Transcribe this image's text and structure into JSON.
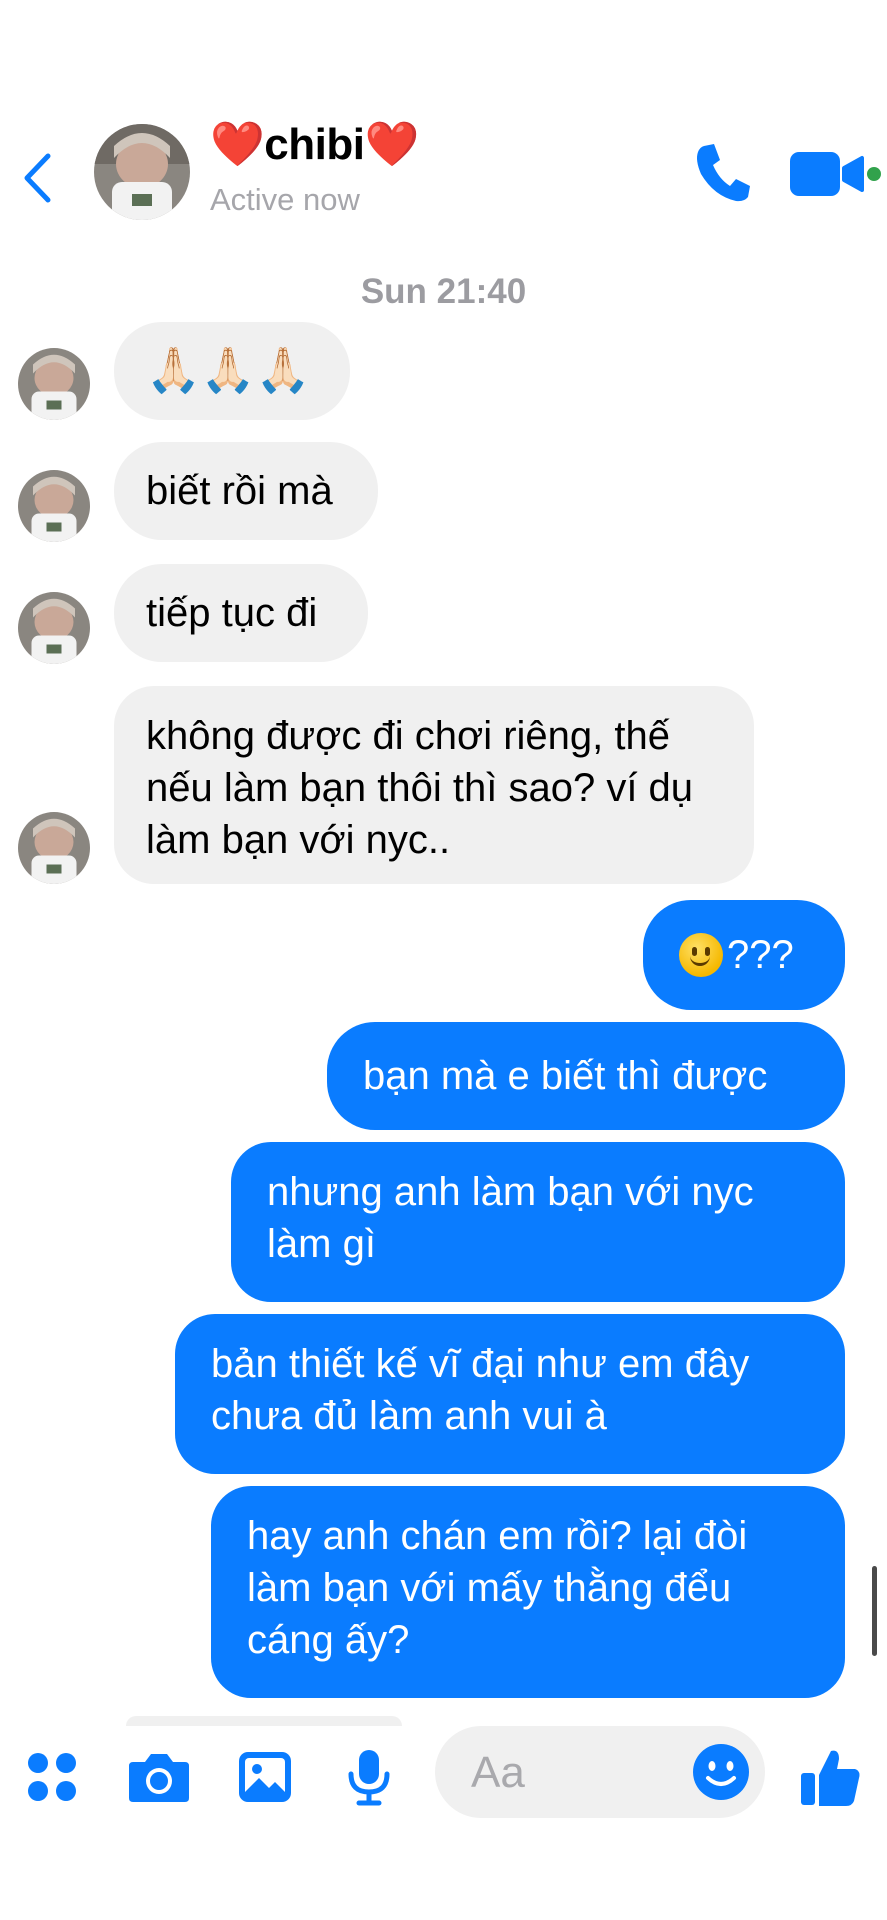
{
  "header": {
    "title": "chibi",
    "heart_left": "❤️",
    "heart_right": "❤️",
    "subtitle": "Active now",
    "icons": {
      "back": "chevron-left-icon",
      "call": "phone-icon",
      "video": "video-camera-icon"
    },
    "accent": "#0a7cff",
    "online_dot": "#31a24c"
  },
  "timestamp": "Sun 21:40",
  "messages_in": [
    {
      "text": "🙏🏻🙏🏻🙏🏻"
    },
    {
      "text": "biết rồi mà"
    },
    {
      "text": "tiếp tục đi"
    },
    {
      "lines": [
        "không được đi chơi riêng, thế",
        "nếu làm bạn thôi thì sao? ví dụ",
        "làm bạn với nyc.."
      ]
    }
  ],
  "messages_out": [
    {
      "emoji": "slightly-smiling-face",
      "text": "???"
    },
    {
      "text": "bạn mà e biết thì được"
    },
    {
      "lines": [
        "nhưng anh làm bạn với nyc",
        "làm gì"
      ]
    },
    {
      "lines": [
        "bản thiết kế vĩ đại như em đây",
        "chưa đủ làm anh vui à"
      ]
    },
    {
      "lines": [
        "hay anh chán em rồi? lại đòi",
        "làm bạn với mấy thằng đểu",
        "cáng ấy?"
      ]
    }
  ],
  "composer": {
    "placeholder": "Aa",
    "icons": [
      "apps-grid-icon",
      "camera-icon",
      "photo-icon",
      "microphone-icon",
      "emoji-icon",
      "thumbs-up-icon"
    ]
  },
  "colors": {
    "bubble_in": "#f0f0f0",
    "bubble_out": "#0a7cff",
    "muted_text": "#a6a6ab"
  }
}
